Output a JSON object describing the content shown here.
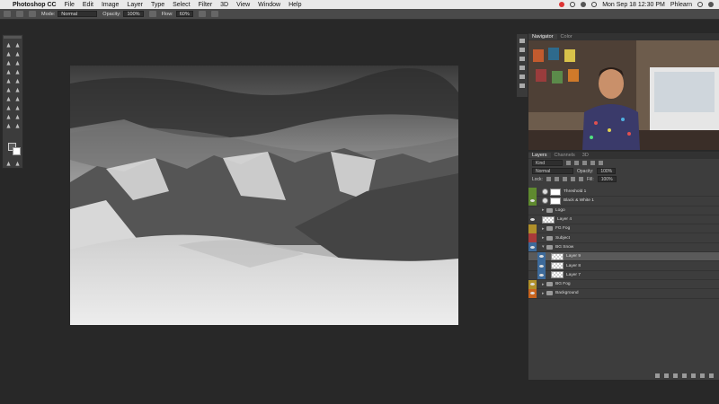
{
  "menubar": {
    "app_name": "Photoshop CC",
    "items": [
      "File",
      "Edit",
      "Image",
      "Layer",
      "Type",
      "Select",
      "Filter",
      "3D",
      "View",
      "Window",
      "Help"
    ],
    "clock": "Mon Sep 18  12:30 PM",
    "user": "Phlearn"
  },
  "options": {
    "mode_label": "Mode:",
    "mode_value": "Normal",
    "opacity_label": "Opacity:",
    "opacity_value": "100%",
    "flow_label": "Flow:",
    "flow_value": "60%"
  },
  "navigator": {
    "tabs": [
      "Navigator",
      "Color"
    ]
  },
  "layers_panel": {
    "tabs": [
      "Layers",
      "Channels",
      "3D"
    ],
    "kind_label": "Kind",
    "blend_value": "Normal",
    "opacity_label": "Opacity:",
    "opacity_value": "100%",
    "lock_label": "Lock:",
    "fill_label": "Fill:",
    "fill_value": "100%",
    "layers": [
      {
        "name": "Threshold 1",
        "kind": "adjustment",
        "eye_color": "#5f8a2f",
        "visible": false
      },
      {
        "name": "Black & White 1",
        "kind": "adjustment",
        "eye_color": "#5f8a2f",
        "visible": true
      },
      {
        "name": "Logo",
        "kind": "group",
        "eye_color": "",
        "visible": false
      },
      {
        "name": "Layer 4",
        "kind": "pixel",
        "eye_color": "",
        "visible": true
      },
      {
        "name": "FG Fog",
        "kind": "group",
        "eye_color": "#b0902a",
        "visible": false
      },
      {
        "name": "Subject",
        "kind": "group",
        "eye_color": "#a83a3a",
        "visible": false
      },
      {
        "name": "BG Snow",
        "kind": "group",
        "eye_color": "#3d6a9a",
        "visible": true
      },
      {
        "name": "Layer 9",
        "kind": "pixel",
        "eye_color": "#3d6a9a",
        "visible": true,
        "selected": true
      },
      {
        "name": "Layer 8",
        "kind": "pixel",
        "eye_color": "#3d6a9a",
        "visible": true
      },
      {
        "name": "Layer 7",
        "kind": "pixel",
        "eye_color": "#3d6a9a",
        "visible": true
      },
      {
        "name": "BG Fog",
        "kind": "group",
        "eye_color": "#b0902a",
        "visible": true
      },
      {
        "name": "Background",
        "kind": "group",
        "eye_color": "#c8641e",
        "visible": true
      }
    ]
  }
}
